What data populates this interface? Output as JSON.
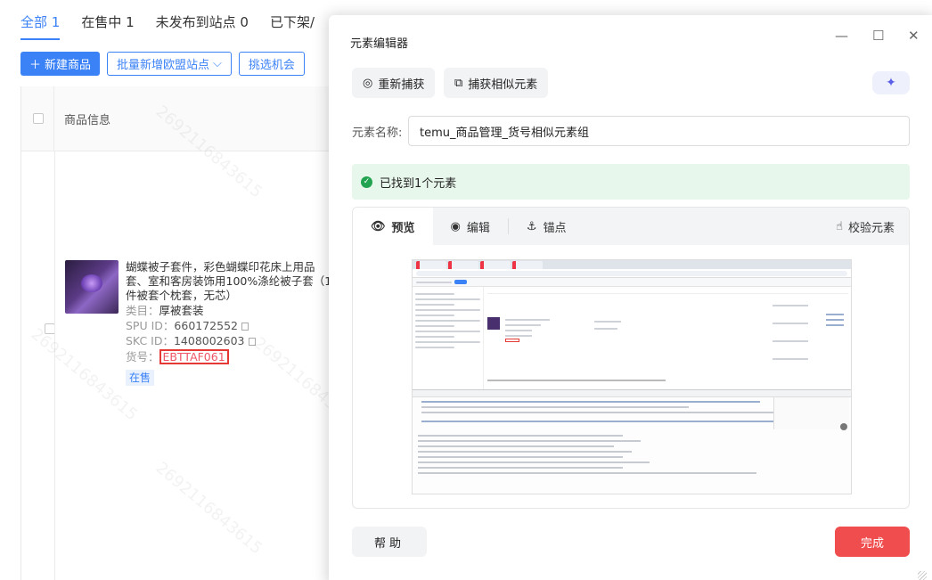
{
  "bg": {
    "tabs": [
      "全部 1",
      "在售中 1",
      "未发布到站点 0",
      "已下架/"
    ],
    "actions": {
      "new_product": "新建商品",
      "batch_eu": "批量新增欧盟站点",
      "pick_opportunity": "挑选机会"
    },
    "table": {
      "header": "商品信息"
    },
    "product": {
      "title": "蝴蝶被子套件，彩色蝴蝶印花床上用品套、室和客房装饰用100%涤纶被子套（1件被套个枕套，无芯）",
      "type_label": "类目：",
      "type_value": "厚被套装",
      "spu_label": "SPU ID：",
      "spu_value": "660172552",
      "skc_label": "SKC ID：",
      "skc_value": "1408002603",
      "sku_label": "货号：",
      "sku_value": "EBTTAF061",
      "status": "在售"
    },
    "watermark": "2692116843615"
  },
  "dialog": {
    "title": "元素编辑器",
    "recapture": "重新捕获",
    "capture_similar": "捕获相似元素",
    "name_label": "元素名称:",
    "name_value": "temu_商品管理_货号相似元素组",
    "found_text": "已找到1个元素",
    "tabs": {
      "preview": "预览",
      "edit": "编辑",
      "anchor": "锚点",
      "verify": "校验元素"
    },
    "help": "帮助",
    "done": "完成"
  },
  "colors": {
    "primary": "#3b82f6",
    "success_bg": "#e8f7ec",
    "success": "#22a350",
    "danger": "#f04e4e"
  }
}
